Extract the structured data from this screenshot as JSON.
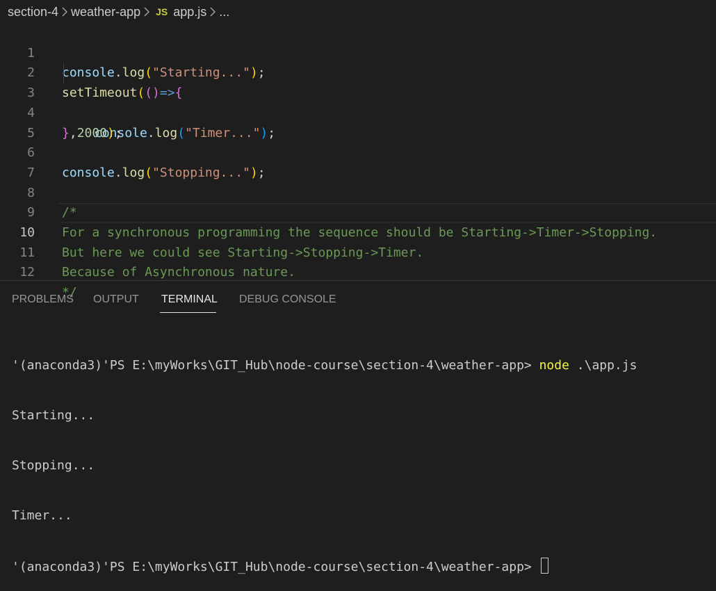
{
  "breadcrumb": {
    "items": [
      "section-4",
      "weather-app",
      "app.js",
      "..."
    ],
    "file_icon": "JS"
  },
  "editor": {
    "active_line": 10,
    "lines": [
      {
        "n": "1"
      },
      {
        "n": "2"
      },
      {
        "n": "3"
      },
      {
        "n": "4"
      },
      {
        "n": "5"
      },
      {
        "n": "6"
      },
      {
        "n": "7"
      },
      {
        "n": "8"
      },
      {
        "n": "9"
      },
      {
        "n": "10"
      },
      {
        "n": "11"
      },
      {
        "n": "12"
      }
    ],
    "tokens": {
      "console": "console",
      "dot": ".",
      "log": "log",
      "lparen": "(",
      "rparen": ")",
      "semi": ";",
      "starting": "\"Starting...\"",
      "setTimeout": "setTimeout",
      "arrow_params": "()",
      "arrow": "=>",
      "lbrace": "{",
      "rbrace": "}",
      "timer": "\"Timer...\"",
      "comma": ",",
      "delay": "2000",
      "stopping": "\"Stopping...\""
    },
    "comment": {
      "open": "/*",
      "line1": "For a synchronous programming the sequence should be Starting->Timer->Stopping.",
      "line2": "But here we could see Starting->Stopping->Timer.",
      "line3": "Because of Asynchronous nature.",
      "close": "*/"
    }
  },
  "panel": {
    "tabs": [
      "PROBLEMS",
      "OUTPUT",
      "TERMINAL",
      "DEBUG CONSOLE"
    ],
    "active_tab": "TERMINAL"
  },
  "terminal": {
    "prompt": "'(anaconda3)'PS E:\\myWorks\\GIT_Hub\\node-course\\section-4\\weather-app> ",
    "command": "node",
    "args": " .\\app.js",
    "output": [
      "Starting...",
      "Stopping...",
      "Timer..."
    ]
  },
  "colors": {
    "background": "#1e1e1e",
    "comment": "#6a9955",
    "string": "#ce9178",
    "function": "#dcdcaa",
    "variable": "#9cdcfe",
    "command": "#f5f543"
  }
}
